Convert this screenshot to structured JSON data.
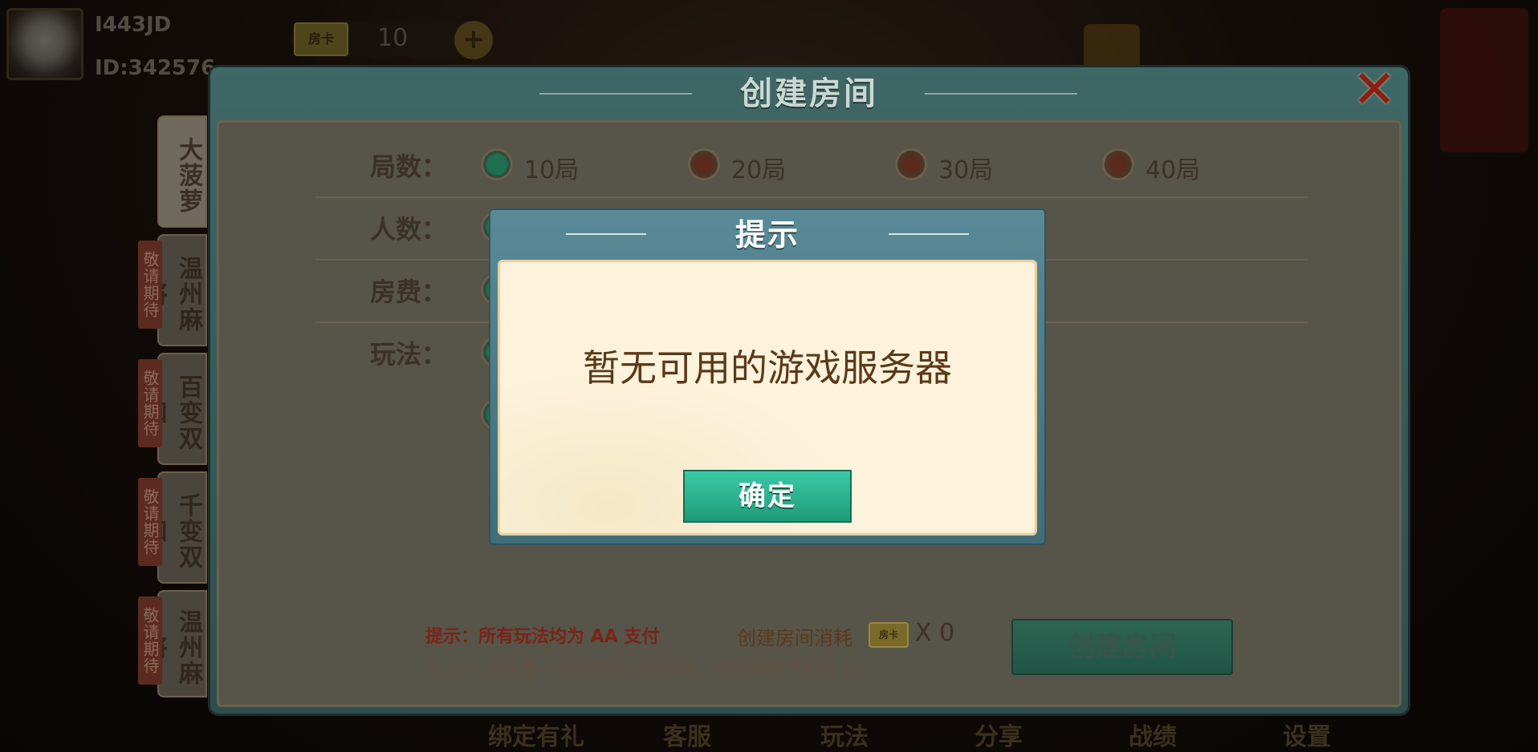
{
  "player": {
    "nickname": "I443JD",
    "id": "ID:342576"
  },
  "currency": {
    "card_label": "房卡",
    "count": "10",
    "add_symbol": "+"
  },
  "panel": {
    "title": "创建房间",
    "close_symbol": "✕"
  },
  "games": [
    {
      "label": "大菠萝",
      "coming_soon": ""
    },
    {
      "label": "温州麻将",
      "coming_soon": "敬请期待"
    },
    {
      "label": "百变双扣",
      "coming_soon": "敬请期待"
    },
    {
      "label": "千变双扣",
      "coming_soon": "敬请期待"
    },
    {
      "label": "温州麻将",
      "coming_soon": "敬请期待"
    }
  ],
  "settings": {
    "rounds": {
      "label": "局数：",
      "options": [
        "10局",
        "20局",
        "30局",
        "40局"
      ],
      "selected": "10局"
    },
    "players": {
      "label": "人数："
    },
    "fee": {
      "label": "房费："
    },
    "play": {
      "label": "玩法："
    }
  },
  "footer": {
    "hint": "提示：所有玩法均为 AA 支付",
    "cost_label": "创建房间消耗",
    "cost_card": "房卡",
    "cost_value": "X 0",
    "note": "注:房卡将在第一局结算的时候扣除，提前解散不扣房卡!",
    "create_button": "创建房间"
  },
  "bottom_nav": [
    "绑定有礼",
    "客服",
    "玩法",
    "分享",
    "战绩",
    "设置"
  ],
  "modal": {
    "title": "提示",
    "message": "暂无可用的游戏服务器",
    "ok_button": "确定"
  },
  "colors": {
    "accent_teal": "#2bb08e",
    "panel_teal": "#3f6766",
    "close_red": "#8b1f12",
    "warning_red": "#7a2416"
  }
}
